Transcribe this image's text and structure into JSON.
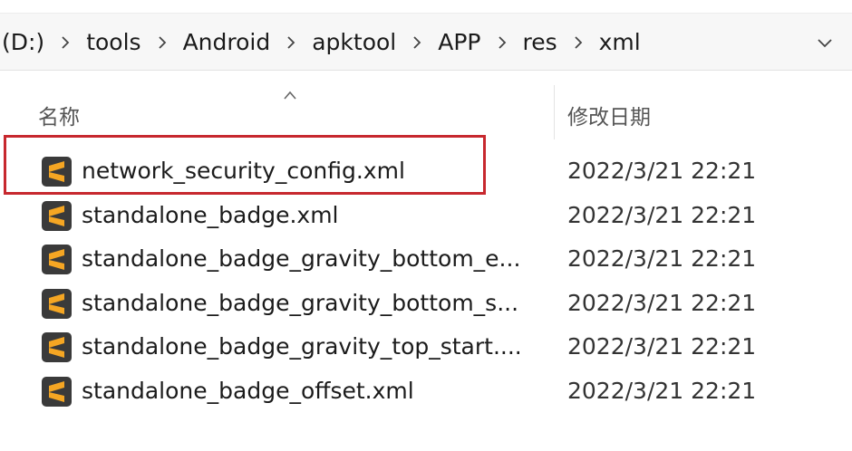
{
  "breadcrumb": {
    "items": [
      {
        "label": "(D:)"
      },
      {
        "label": "tools"
      },
      {
        "label": "Android"
      },
      {
        "label": "apktool"
      },
      {
        "label": "APP"
      },
      {
        "label": "res"
      },
      {
        "label": "xml"
      }
    ]
  },
  "columns": {
    "name": "名称",
    "date_modified": "修改日期"
  },
  "files": [
    {
      "name": "network_security_config.xml",
      "date": "2022/3/21 22:21",
      "highlighted": true
    },
    {
      "name": "standalone_badge.xml",
      "date": "2022/3/21 22:21",
      "highlighted": false
    },
    {
      "name": "standalone_badge_gravity_bottom_e...",
      "date": "2022/3/21 22:21",
      "highlighted": false
    },
    {
      "name": "standalone_badge_gravity_bottom_s...",
      "date": "2022/3/21 22:21",
      "highlighted": false
    },
    {
      "name": "standalone_badge_gravity_top_start....",
      "date": "2022/3/21 22:21",
      "highlighted": false
    },
    {
      "name": "standalone_badge_offset.xml",
      "date": "2022/3/21 22:21",
      "highlighted": false
    }
  ],
  "colors": {
    "highlight": "#c7282e",
    "file_icon_bg": "#3a3a3a",
    "file_icon_glyph": "#f5a623"
  },
  "icons": {
    "file": "sublime-text-file-icon",
    "separator": "chevron-right-icon",
    "dropdown": "chevron-down-icon",
    "sort": "sort-up-icon"
  }
}
